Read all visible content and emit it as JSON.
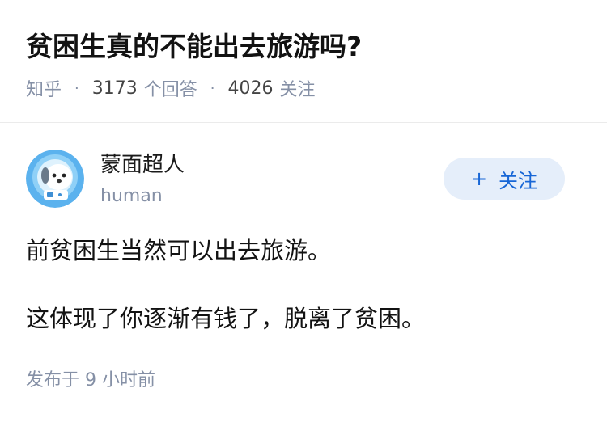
{
  "question": {
    "title": "贫困生真的不能出去旅游吗?",
    "source": "知乎",
    "answer_count": "3173",
    "answer_label": "个回答",
    "follower_count": "4026",
    "follower_label": "关注"
  },
  "answer": {
    "author": {
      "name": "蒙面超人",
      "headline": "human",
      "avatar_icon": "dog-astronaut-avatar"
    },
    "follow_button": {
      "icon": "+",
      "label": "关注"
    },
    "paragraphs": [
      "前贫困生当然可以出去旅游。",
      "这体现了你逐渐有钱了，脱离了贫困。"
    ],
    "published_time": "发布于 9 小时前"
  },
  "colors": {
    "accent": "#1766d6",
    "button_bg": "#e5eefa",
    "meta_text": "#8590a6",
    "avatar_bg": "#5bb2ee"
  }
}
